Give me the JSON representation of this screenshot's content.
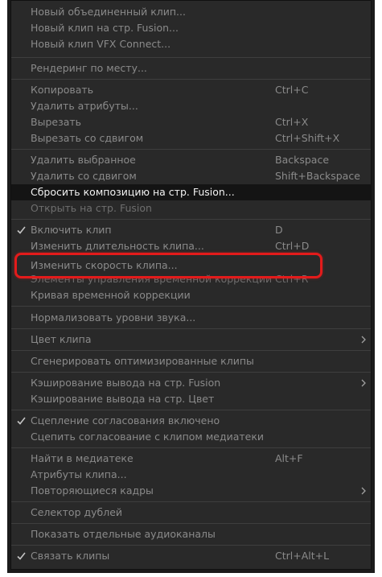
{
  "colors": {
    "menu_bg": "#292929",
    "text": "#c4c4c4",
    "active_bg": "#141414",
    "highlight": "#e31b1b"
  },
  "icons": {
    "check": "check-icon",
    "submenu": "chevron-right-icon"
  },
  "menu": {
    "group1": [
      {
        "label": "Новый объединенный клип..."
      },
      {
        "label": "Новый клип на стр. Fusion..."
      },
      {
        "label": "Новый клип VFX Connect..."
      }
    ],
    "group2": [
      {
        "label": "Рендеринг по месту..."
      }
    ],
    "group3": [
      {
        "label": "Копировать",
        "shortcut": "Ctrl+C"
      },
      {
        "label": "Удалить атрибуты..."
      },
      {
        "label": "Вырезать",
        "shortcut": "Ctrl+X"
      },
      {
        "label": "Вырезать со сдвигом",
        "shortcut": "Ctrl+Shift+X"
      }
    ],
    "group4": [
      {
        "label": "Удалить выбранное",
        "shortcut": "Backspace"
      },
      {
        "label": "Удалить со сдвигом",
        "shortcut": "Shift+Backspace"
      },
      {
        "label": "Сбросить композицию на стр. Fusion..."
      },
      {
        "label": "Открыть на стр. Fusion"
      }
    ],
    "group5": [
      {
        "label": "Включить клип",
        "shortcut": "D"
      },
      {
        "label": "Изменить длительность клипа...",
        "shortcut": "Ctrl+D"
      },
      {
        "label": "Изменить скорость клипа..."
      },
      {
        "label": "Элементы управления временной коррекции",
        "shortcut": "Ctrl+R"
      },
      {
        "label": "Кривая временной коррекции"
      }
    ],
    "group6": [
      {
        "label": "Нормализовать уровни звука..."
      }
    ],
    "group7": [
      {
        "label": "Цвет клипа"
      }
    ],
    "group8": [
      {
        "label": "Сгенерировать оптимизированные клипы"
      }
    ],
    "group9": [
      {
        "label": "Кэширование вывода на стр. Fusion"
      },
      {
        "label": "Кэширование вывода на стр. Цвет"
      }
    ],
    "group10": [
      {
        "label": "Сцепление согласования включено"
      },
      {
        "label": "Сцепить согласование с клипом медиатеки"
      }
    ],
    "group11": [
      {
        "label": "Найти в медиатеке",
        "shortcut": "Alt+F"
      },
      {
        "label": "Атрибуты клипа..."
      },
      {
        "label": "Повторяющиеся кадры"
      }
    ],
    "group12": [
      {
        "label": "Селектор дублей"
      }
    ],
    "group13": [
      {
        "label": "Показать отдельные аудиоканалы"
      }
    ],
    "group14": [
      {
        "label": "Связать клипы",
        "shortcut": "Ctrl+Alt+L"
      }
    ]
  }
}
